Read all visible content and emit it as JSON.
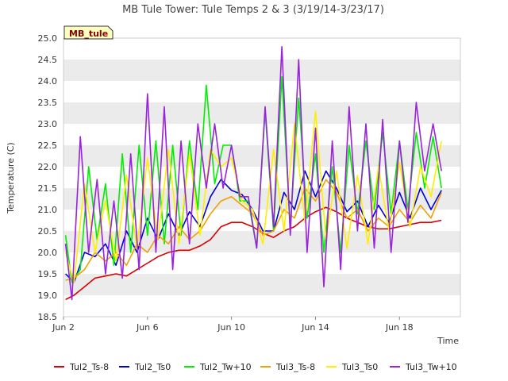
{
  "chart_data": {
    "type": "line",
    "title": "MB Tule Tower: Tule Temps 2 & 3 (3/19/14-3/23/17)",
    "badge": "MB_tule",
    "xlabel": "Time",
    "ylabel": "Temperature (C)",
    "xlim": [
      2,
      20.9
    ],
    "ylim": [
      18.5,
      25.0
    ],
    "x_ticks": [
      {
        "value": 2,
        "label": "Jun 2"
      },
      {
        "value": 6,
        "label": "Jun 6"
      },
      {
        "value": 10,
        "label": "Jun 10"
      },
      {
        "value": 14,
        "label": "Jun 14"
      },
      {
        "value": 18,
        "label": "Jun 18"
      }
    ],
    "y_ticks": [
      18.5,
      19.0,
      19.5,
      20.0,
      20.5,
      21.0,
      21.5,
      22.0,
      22.5,
      23.0,
      23.5,
      24.0,
      24.5,
      25.0
    ],
    "grid": "horizontal bands",
    "legend_position": "bottom",
    "series": [
      {
        "name": "Tul2_Ts-8",
        "color": "#dd0000",
        "x": [
          2.1,
          2.5,
          3.0,
          3.5,
          4.0,
          4.5,
          5.0,
          5.5,
          6.0,
          6.5,
          7.0,
          7.5,
          8.0,
          8.5,
          9.0,
          9.5,
          10.0,
          10.5,
          11.0,
          11.5,
          12.0,
          12.5,
          13.0,
          13.5,
          14.0,
          14.5,
          15.0,
          15.5,
          16.0,
          16.5,
          17.0,
          17.5,
          18.0,
          18.5,
          19.0,
          19.5,
          20.0
        ],
        "values": [
          18.9,
          19.0,
          19.2,
          19.4,
          19.45,
          19.5,
          19.45,
          19.6,
          19.75,
          19.9,
          20.0,
          20.05,
          20.05,
          20.15,
          20.3,
          20.6,
          20.7,
          20.7,
          20.6,
          20.45,
          20.35,
          20.5,
          20.6,
          20.8,
          20.95,
          21.05,
          20.95,
          20.8,
          20.7,
          20.6,
          20.55,
          20.55,
          20.6,
          20.65,
          20.7,
          20.7,
          20.75
        ]
      },
      {
        "name": "Tul2_Ts0",
        "color": "#0000dd",
        "x": [
          2.1,
          2.5,
          3.0,
          3.5,
          4.0,
          4.5,
          5.0,
          5.5,
          6.0,
          6.5,
          7.0,
          7.5,
          8.0,
          8.5,
          9.0,
          9.5,
          10.0,
          10.5,
          11.0,
          11.5,
          12.0,
          12.5,
          13.0,
          13.5,
          14.0,
          14.5,
          15.0,
          15.5,
          16.0,
          16.5,
          17.0,
          17.5,
          18.0,
          18.5,
          19.0,
          19.5,
          20.0
        ],
        "values": [
          19.5,
          19.3,
          20.0,
          19.9,
          20.2,
          19.7,
          20.5,
          20.0,
          20.8,
          20.3,
          20.9,
          20.4,
          20.95,
          20.6,
          21.3,
          21.7,
          21.45,
          21.35,
          21.0,
          20.5,
          20.5,
          21.4,
          21.0,
          21.9,
          21.3,
          21.9,
          21.5,
          20.95,
          21.2,
          20.6,
          21.1,
          20.7,
          21.4,
          20.8,
          21.5,
          21.0,
          21.45
        ]
      },
      {
        "name": "Tul2_Tw+10",
        "color": "#00ee00",
        "x": [
          2.1,
          2.4,
          2.8,
          3.2,
          3.6,
          4.0,
          4.4,
          4.8,
          5.2,
          5.6,
          6.0,
          6.4,
          6.8,
          7.2,
          7.6,
          8.0,
          8.4,
          8.8,
          9.2,
          9.6,
          10.0,
          10.4,
          10.8,
          11.2,
          11.6,
          12.0,
          12.4,
          12.8,
          13.2,
          13.6,
          14.0,
          14.4,
          14.8,
          15.2,
          15.6,
          16.0,
          16.4,
          16.8,
          17.2,
          17.6,
          18.0,
          18.4,
          18.8,
          19.2,
          19.6,
          20.0
        ],
        "values": [
          20.4,
          19.3,
          19.6,
          22.0,
          20.3,
          21.6,
          19.7,
          22.3,
          20.0,
          22.5,
          20.4,
          22.6,
          20.2,
          22.5,
          20.4,
          22.6,
          21.0,
          23.9,
          21.6,
          22.5,
          22.5,
          21.2,
          21.2,
          20.1,
          23.3,
          20.5,
          24.1,
          20.6,
          23.6,
          20.8,
          22.3,
          20.0,
          22.0,
          20.0,
          22.5,
          20.9,
          22.6,
          21.0,
          22.8,
          20.9,
          22.6,
          21.0,
          22.8,
          21.5,
          22.7,
          21.5
        ]
      },
      {
        "name": "Tul3_Ts-8",
        "color": "#f0a000",
        "x": [
          2.1,
          2.5,
          3.0,
          3.5,
          4.0,
          4.5,
          5.0,
          5.5,
          6.0,
          6.5,
          7.0,
          7.5,
          8.0,
          8.5,
          9.0,
          9.5,
          10.0,
          10.5,
          11.0,
          11.5,
          12.0,
          12.5,
          13.0,
          13.5,
          14.0,
          14.5,
          15.0,
          15.5,
          16.0,
          16.5,
          17.0,
          17.5,
          18.0,
          18.5,
          19.0,
          19.5,
          20.0
        ],
        "values": [
          19.35,
          19.4,
          19.6,
          20.0,
          19.8,
          20.0,
          19.7,
          20.2,
          20.0,
          20.4,
          20.2,
          20.6,
          20.3,
          20.5,
          20.9,
          21.2,
          21.3,
          21.1,
          20.9,
          20.4,
          20.5,
          21.0,
          20.8,
          21.5,
          21.2,
          21.7,
          21.4,
          20.8,
          21.0,
          20.5,
          20.8,
          20.6,
          21.0,
          20.7,
          21.1,
          20.8,
          21.4
        ]
      },
      {
        "name": "Tul3_Ts0",
        "color": "#ffee00",
        "x": [
          2.1,
          2.5,
          3.0,
          3.5,
          4.0,
          4.5,
          5.0,
          5.5,
          6.0,
          6.5,
          7.0,
          7.5,
          8.0,
          8.5,
          9.0,
          9.5,
          10.0,
          10.5,
          11.0,
          11.5,
          12.0,
          12.5,
          13.0,
          13.5,
          14.0,
          14.5,
          15.0,
          15.5,
          16.0,
          16.5,
          17.0,
          17.5,
          18.0,
          18.5,
          19.0,
          19.5,
          20.0
        ],
        "values": [
          20.0,
          19.3,
          21.6,
          20.0,
          21.2,
          19.8,
          21.8,
          20.1,
          22.2,
          20.3,
          22.4,
          20.2,
          22.3,
          20.4,
          22.4,
          22.0,
          22.2,
          21.2,
          21.0,
          20.2,
          22.4,
          20.5,
          23.0,
          20.7,
          23.3,
          20.3,
          21.9,
          20.1,
          21.8,
          20.2,
          22.0,
          20.5,
          22.1,
          20.6,
          22.0,
          21.3,
          22.6
        ]
      },
      {
        "name": "Tul3_Tw+10",
        "color": "#9922dd",
        "x": [
          2.1,
          2.4,
          2.8,
          3.2,
          3.6,
          4.0,
          4.4,
          4.8,
          5.2,
          5.6,
          6.0,
          6.4,
          6.8,
          7.2,
          7.6,
          8.0,
          8.4,
          8.8,
          9.2,
          9.6,
          10.0,
          10.4,
          10.8,
          11.2,
          11.6,
          12.0,
          12.4,
          12.8,
          13.2,
          13.6,
          14.0,
          14.4,
          14.8,
          15.2,
          15.6,
          16.0,
          16.4,
          16.8,
          17.2,
          17.6,
          18.0,
          18.4,
          18.8,
          19.2,
          19.6,
          20.0
        ],
        "values": [
          20.2,
          18.9,
          22.7,
          20.0,
          21.7,
          19.5,
          21.2,
          19.4,
          22.3,
          19.6,
          23.7,
          20.0,
          23.4,
          19.6,
          22.6,
          20.2,
          23.0,
          21.5,
          23.0,
          21.5,
          22.5,
          21.3,
          21.3,
          20.1,
          23.4,
          20.6,
          24.8,
          20.4,
          24.5,
          20.0,
          22.9,
          19.2,
          22.6,
          19.6,
          23.4,
          20.5,
          23.0,
          20.1,
          23.1,
          20.0,
          22.6,
          20.7,
          23.5,
          21.9,
          23.0,
          21.9
        ]
      }
    ]
  }
}
